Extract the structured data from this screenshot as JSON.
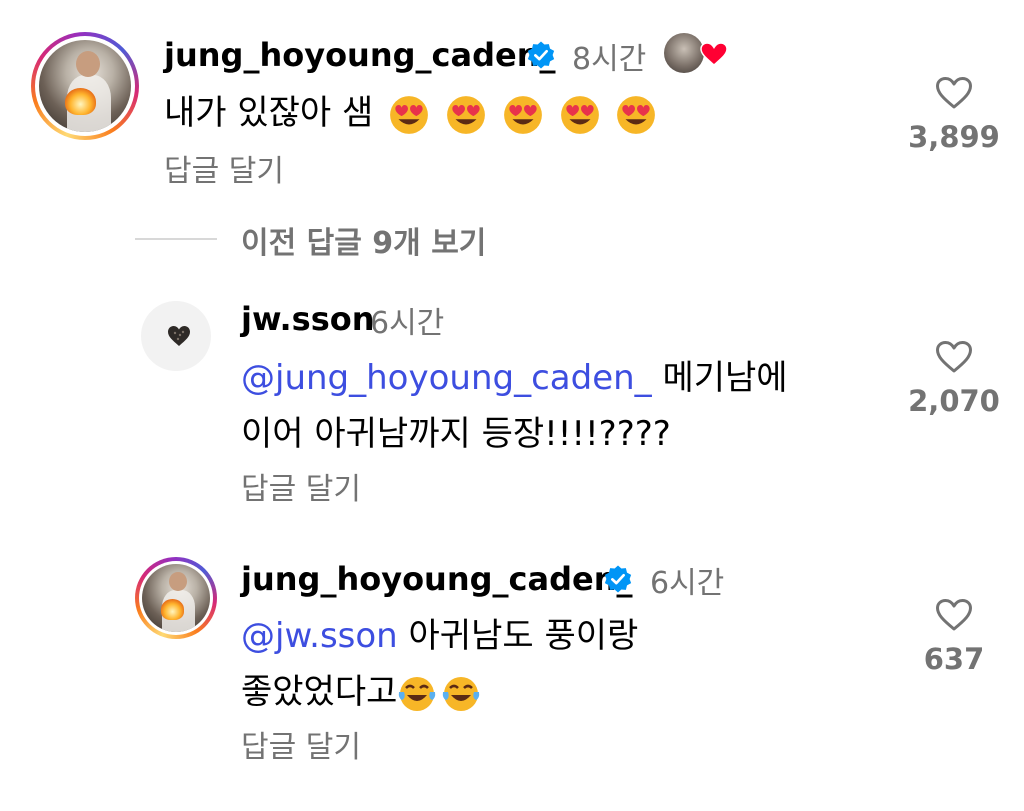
{
  "colors": {
    "username": "#000000",
    "secondary_text": "#737373",
    "mention": "#3d4ee0",
    "verified_badge": "#0095f6",
    "liked_heart": "#ff0033"
  },
  "thread": {
    "view_previous_replies": "이전 답글 9개 보기",
    "comments": [
      {
        "username": "jung_hoyoung_caden_",
        "verified": true,
        "time": "8시간",
        "creator_liked": true,
        "text": "내가 있잖아 샘",
        "emoji": "heart-eyes-emoji",
        "emoji_count": 5,
        "reply_label": "답글 달기",
        "like_count": "3,899"
      },
      {
        "username": "jw.sson",
        "verified": false,
        "time": "6시간",
        "mention": "@jung_hoyoung_caden_",
        "text_line1": " 메기남에",
        "text_line2": "이어 아귀남까지 등장!!!!????",
        "reply_label": "답글 달기",
        "like_count": "2,070"
      },
      {
        "username": "jung_hoyoung_caden_",
        "verified": true,
        "time": "6시간",
        "mention": "@jw.sson",
        "text_line1": " 아귀남도 풍이랑",
        "text_line2": "좋았었다고",
        "emoji": "tears-of-joy-emoji",
        "emoji_count": 2,
        "reply_label": "답글 달기",
        "like_count": "637"
      }
    ]
  }
}
